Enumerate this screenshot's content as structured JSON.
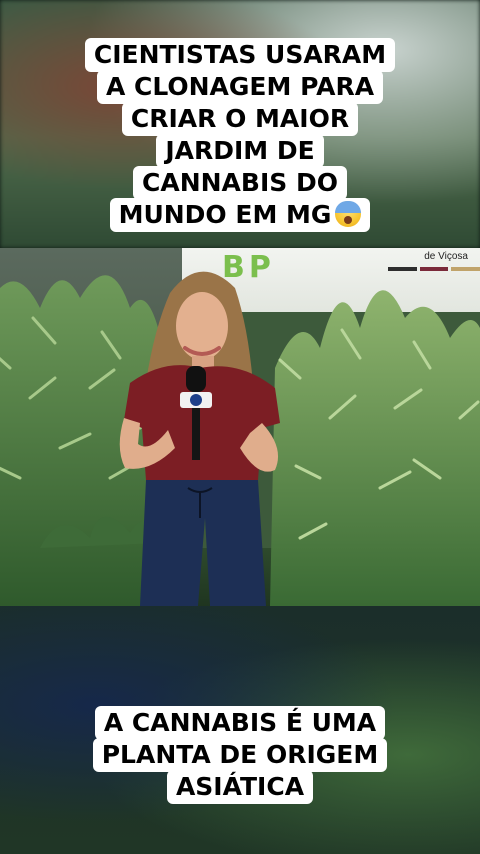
{
  "caption_top": {
    "lines": [
      "CIENTISTAS USARAM",
      "A CLONAGEM PARA",
      "CRIAR O MAIOR",
      "JARDIM DE",
      "CANNABIS DO",
      "MUNDO EM MG"
    ],
    "emoji": "screaming-face-emoji"
  },
  "caption_bottom": {
    "lines": [
      "A CANNABIS É UMA",
      "PLANTA DE ORIGEM",
      "ASIÁTICA"
    ]
  },
  "video": {
    "sign_caption": "de Viçosa",
    "sign_bar_colors": [
      "#2d2d2d",
      "#7a2a3a",
      "#c0a36a"
    ]
  }
}
